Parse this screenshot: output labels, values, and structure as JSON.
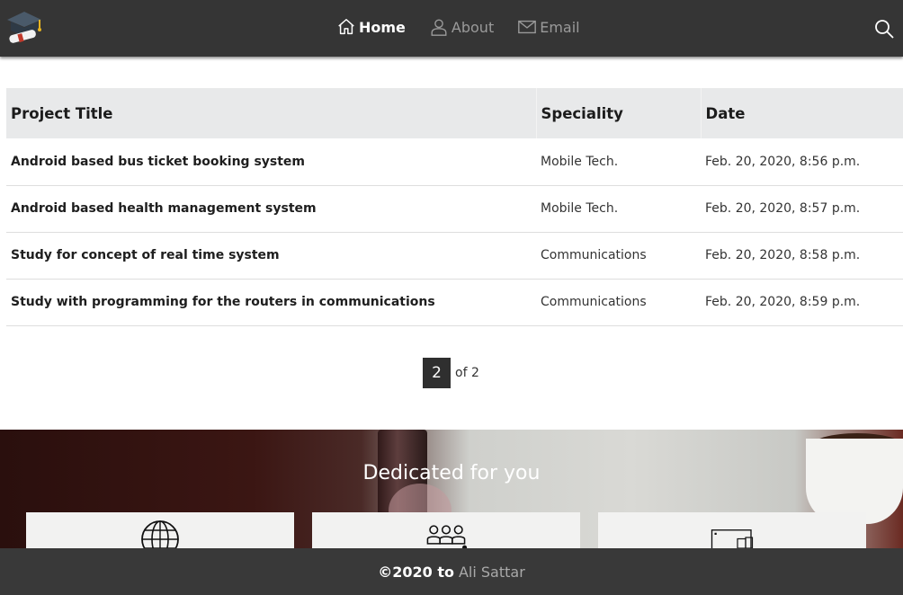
{
  "nav": {
    "logo_icon": "graduation-cap-logo",
    "items": [
      {
        "label": "Home",
        "icon": "home-icon",
        "active": true
      },
      {
        "label": "About",
        "icon": "user-icon",
        "active": false
      },
      {
        "label": "Email",
        "icon": "envelope-icon",
        "active": false
      }
    ],
    "search_icon": "search-icon"
  },
  "table": {
    "headers": [
      "Project Title",
      "Speciality",
      "Date"
    ],
    "rows": [
      {
        "title": "Android based bus ticket booking system",
        "speciality": "Mobile Tech.",
        "date": "Feb. 20, 2020, 8:56 p.m."
      },
      {
        "title": "Android based health management system",
        "speciality": "Mobile Tech.",
        "date": "Feb. 20, 2020, 8:57 p.m."
      },
      {
        "title": "Study for concept of real time system",
        "speciality": "Communications",
        "date": "Feb. 20, 2020, 8:58 p.m."
      },
      {
        "title": "Study with programming for the routers in communications",
        "speciality": "Communications",
        "date": "Feb. 20, 2020, 8:59 p.m."
      }
    ]
  },
  "pagination": {
    "current": "2",
    "of_text": "of 2"
  },
  "hero": {
    "title": "Dedicated for you",
    "cards": [
      {
        "icon": "globe-icon"
      },
      {
        "icon": "team-icon"
      },
      {
        "icon": "devices-icon"
      }
    ]
  },
  "footer": {
    "copyright": "©2020 to",
    "author": "Ali Sattar"
  },
  "colors": {
    "nav_bg": "#353535",
    "footer_bg": "#393939",
    "header_row_bg": "#e8e9ea",
    "page_active_bg": "#2f2f2f"
  }
}
